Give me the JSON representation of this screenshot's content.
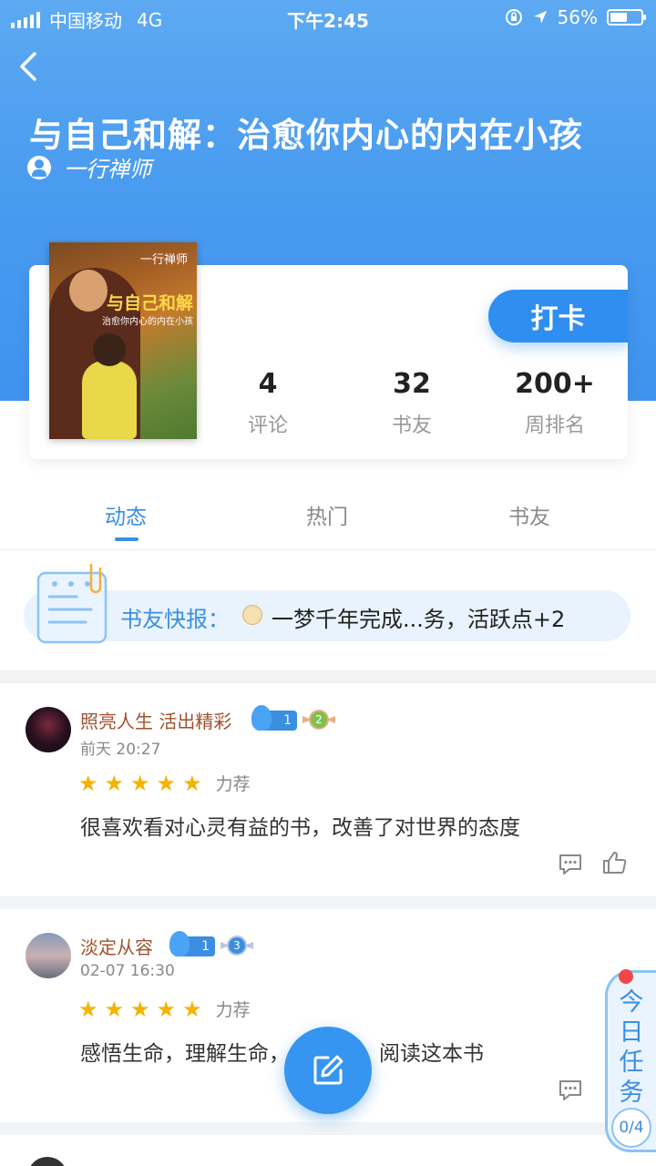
{
  "status_bar": {
    "carrier": "中国移动",
    "network": "4G",
    "time": "下午2:45",
    "battery_percent": "56%",
    "battery_level": 0.56
  },
  "header": {
    "title": "与自己和解：治愈你内心的内在小孩",
    "author": "一行禅师",
    "back_icon": "chevron-left-icon"
  },
  "book_card": {
    "cover": {
      "author": "一行禅师",
      "title": "与自己和解",
      "subtitle": "治愈你内心的内在小孩"
    },
    "checkin_label": "打卡",
    "stats": [
      {
        "value": "4",
        "label": "评论"
      },
      {
        "value": "32",
        "label": "书友"
      },
      {
        "value": "200+",
        "label": "周排名"
      }
    ]
  },
  "tabs": [
    {
      "label": "动态",
      "active": true
    },
    {
      "label": "热门",
      "active": false
    },
    {
      "label": "书友",
      "active": false
    }
  ],
  "news": {
    "label": "书友快报：",
    "text": "一梦千年完成...务，活跃点+2"
  },
  "posts": [
    {
      "user": "照亮人生 活出精彩",
      "time": "前天 20:27",
      "level": "1",
      "badge": "2",
      "rating": 5,
      "rating_label": "力荐",
      "content": "很喜欢看对心灵有益的书，改善了对世界的态度"
    },
    {
      "user": "淡定从容",
      "time": "02-07 16:30",
      "level": "1",
      "badge": "3",
      "rating": 5,
      "rating_label": "力荐",
      "content": "感悟生命，理解生命，",
      "content_tail": "阅读这本书"
    }
  ],
  "task_panel": {
    "label": "今日任务",
    "count": "0/4"
  },
  "colors": {
    "primary": "#3b8ee0",
    "header_blue": "#4a9cf0",
    "star": "#f5b300",
    "username": "#a0522d",
    "badge_red": "#f04848"
  }
}
